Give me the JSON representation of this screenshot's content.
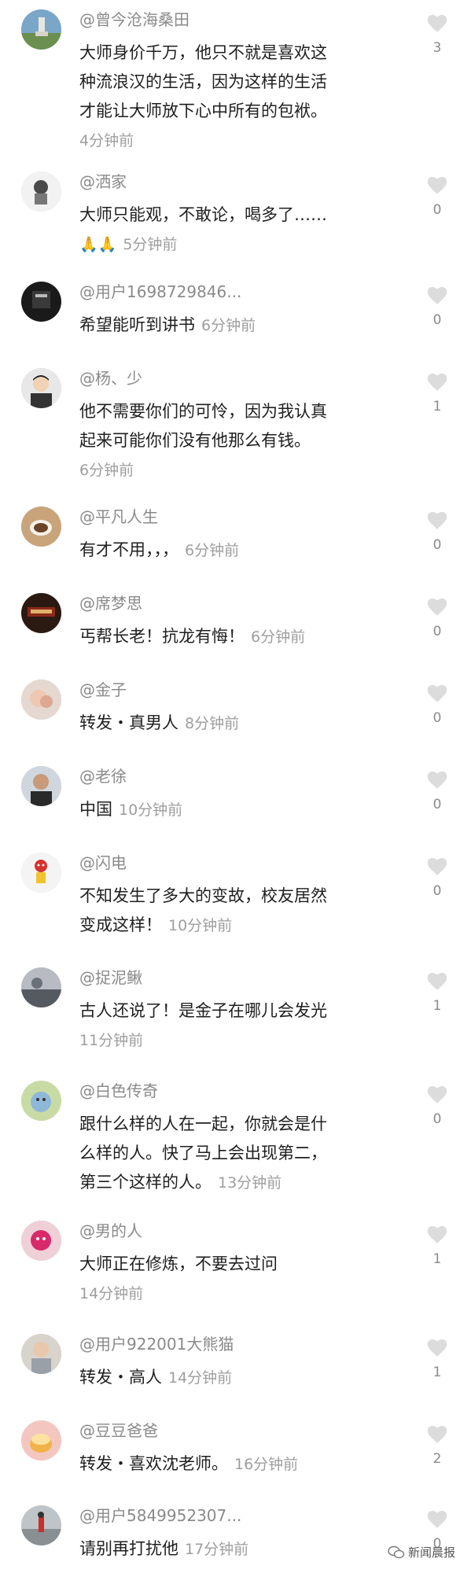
{
  "comments": [
    {
      "user": "@曾今沧海桑田",
      "text_lines": [
        "大师身价千万，他只不就是喜欢这",
        "种流浪汉的生活，因为这样的生活",
        "才能让大师放下心中所有的包袱。"
      ],
      "time": "4分钟前",
      "likes": "3"
    },
    {
      "user": "@洒家",
      "text_lines": [
        "大师只能观，不敢论，喝多了……"
      ],
      "emoji": "🙏🙏",
      "time": "5分钟前",
      "likes": "0"
    },
    {
      "user": "@用户1698729846...",
      "text_lines": [
        "希望能听到讲书"
      ],
      "time": "6分钟前",
      "likes": "0"
    },
    {
      "user": "@杨、少",
      "text_lines": [
        "他不需要你们的可怜，因为我认真",
        "起来可能你们没有他那么有钱。"
      ],
      "time": "6分钟前",
      "likes": "1"
    },
    {
      "user": "@平凡人生",
      "text_lines": [
        "有才不用，，，"
      ],
      "time": "6分钟前",
      "likes": "0"
    },
    {
      "user": "@席梦思",
      "text_lines": [
        "丐帮长老！抗龙有悔！"
      ],
      "time": "6分钟前",
      "likes": "0"
    },
    {
      "user": "@金子",
      "text_lines": [
        "转发・真男人"
      ],
      "time": "8分钟前",
      "likes": "0"
    },
    {
      "user": "@老徐",
      "text_lines": [
        "中国"
      ],
      "time": "10分钟前",
      "likes": "0"
    },
    {
      "user": "@闪电",
      "text_lines": [
        "不知发生了多大的变故，校友居然",
        "变成这样！"
      ],
      "time": "10分钟前",
      "likes": "0"
    },
    {
      "user": "@捉泥鳅",
      "text_lines": [
        "古人还说了！是金子在哪儿会发光"
      ],
      "time": "11分钟前",
      "likes": "1"
    },
    {
      "user": "@白色传奇",
      "text_lines": [
        "跟什么样的人在一起，你就会是什",
        "么样的人。快了马上会出现第二，",
        "第三个这样的人。"
      ],
      "time": "13分钟前",
      "likes": "0"
    },
    {
      "user": "@男的人",
      "text_lines": [
        "大师正在修炼，不要去过问"
      ],
      "time": "14分钟前",
      "likes": "1"
    },
    {
      "user": "@用户922001大熊猫",
      "text_lines": [
        "转发・高人"
      ],
      "time": "14分钟前",
      "likes": "1"
    },
    {
      "user": "@豆豆爸爸",
      "text_lines": [
        "转发・喜欢沈老师。"
      ],
      "time": "16分钟前",
      "likes": "2"
    },
    {
      "user": "@用户5849952307...",
      "text_lines": [
        "请别再打扰他"
      ],
      "time": "17分钟前",
      "likes": "0"
    }
  ],
  "watermark": "新闻晨报",
  "icons": {
    "like": "heart-icon",
    "watermark": "wechat-icon"
  },
  "colors": {
    "heart": "#dcdcdc",
    "username": "#8a8a8a",
    "time": "#9e9e9e",
    "text": "#1f1f1f"
  }
}
